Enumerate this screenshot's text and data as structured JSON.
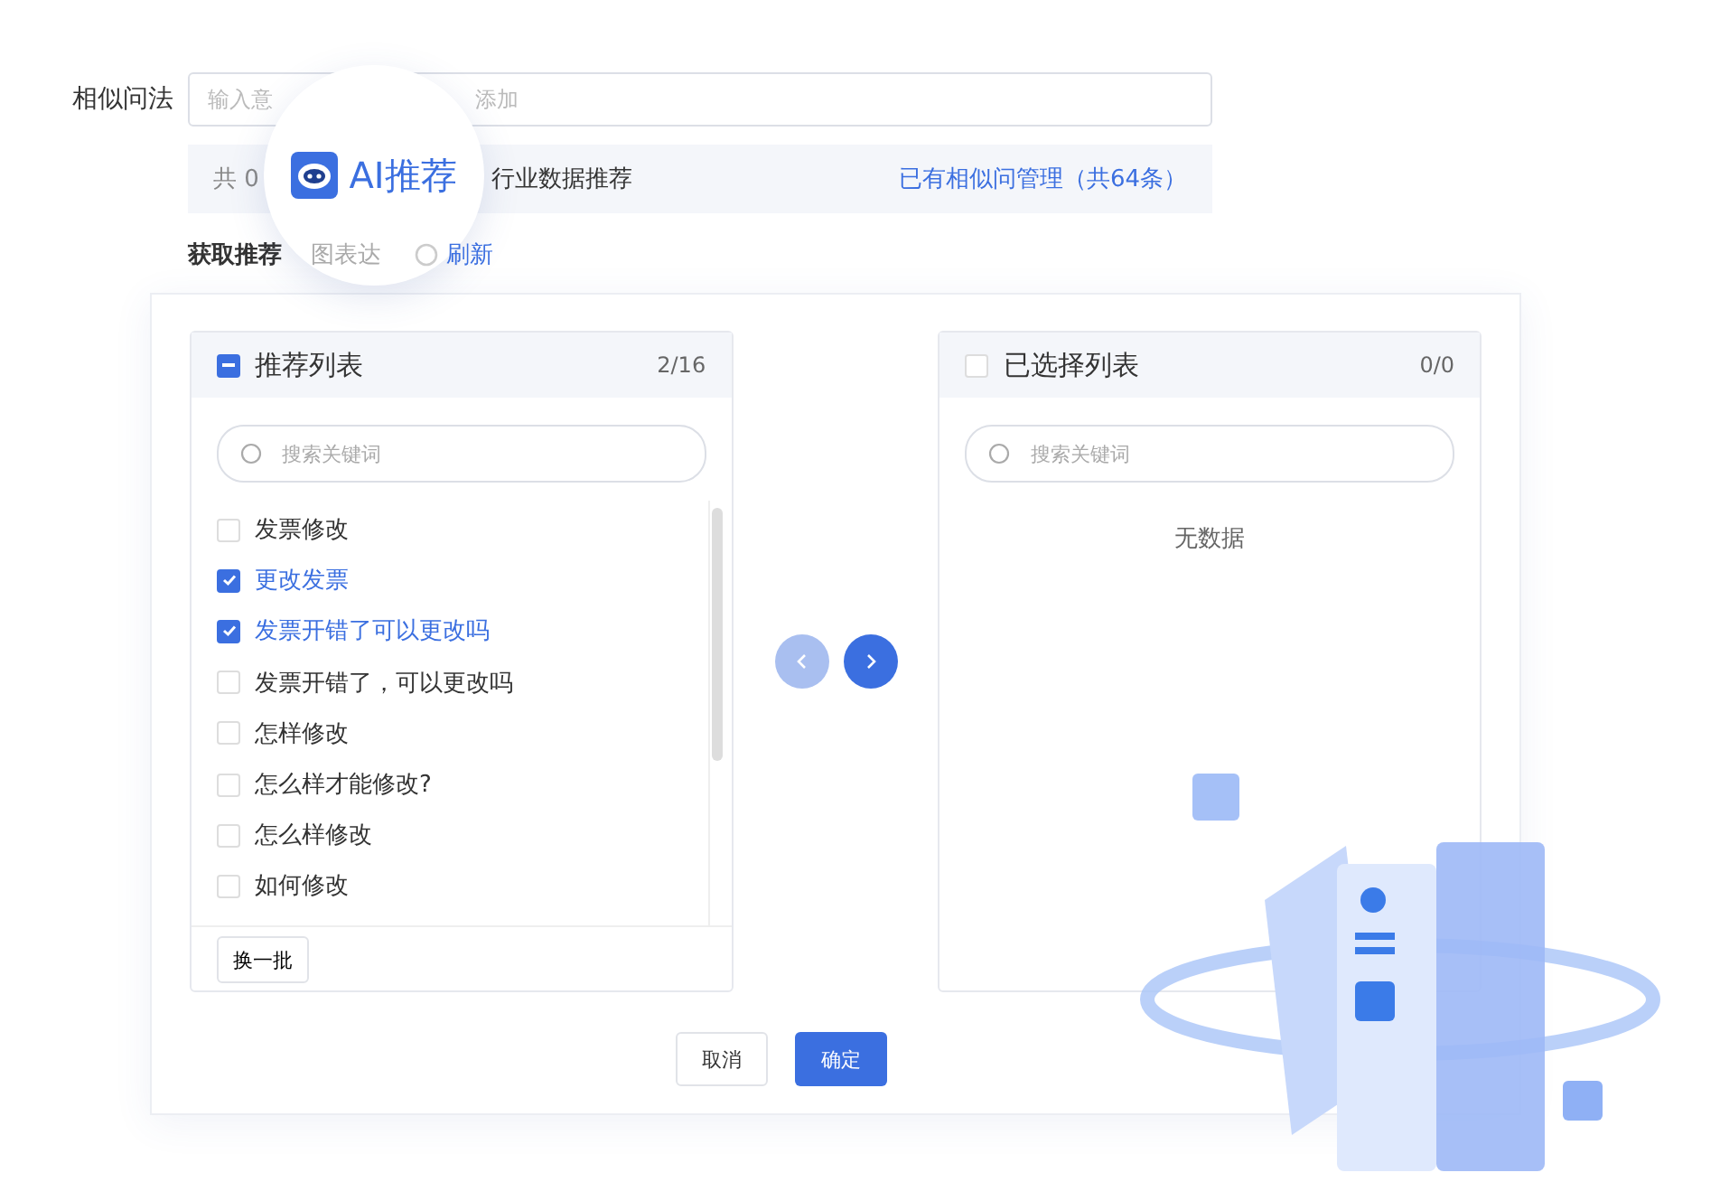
{
  "form_label": "相似问法",
  "field": {
    "placeholder_start": "输入意",
    "placeholder_end": "添加"
  },
  "info_bar": {
    "count_text": "共 0",
    "source_text": "行业数据推荐",
    "manage_link": "已有相似问管理（共64条）"
  },
  "magnifier": {
    "label": "AI推荐"
  },
  "fetch_row": {
    "label": "获取推荐",
    "faded": "图表达",
    "refresh": "刷新"
  },
  "left_panel": {
    "title": "推荐列表",
    "count": "2/16",
    "indeterminate": true,
    "search_placeholder": "搜索关键词",
    "items": [
      {
        "label": "发票修改",
        "checked": false
      },
      {
        "label": "更改发票",
        "checked": true
      },
      {
        "label": "发票开错了可以更改吗",
        "checked": true
      },
      {
        "label": "发票开错了，可以更改吗",
        "checked": false
      },
      {
        "label": "怎样修改",
        "checked": false
      },
      {
        "label": "怎么样才能修改?",
        "checked": false
      },
      {
        "label": "怎么样修改",
        "checked": false
      },
      {
        "label": "如何修改",
        "checked": false
      }
    ],
    "footer_button": "换一批"
  },
  "move_buttons": [
    {
      "kind": "prev",
      "disabled": true
    },
    {
      "kind": "next",
      "disabled": false
    }
  ],
  "right_panel": {
    "title": "已选择列表",
    "count": "0/0",
    "indeterminate": false,
    "search_placeholder": "搜索关键词",
    "empty_text": "无数据"
  },
  "buttons": [
    {
      "label": "取消",
      "kind": "secondary"
    },
    {
      "label": "确定",
      "kind": "primary"
    }
  ]
}
